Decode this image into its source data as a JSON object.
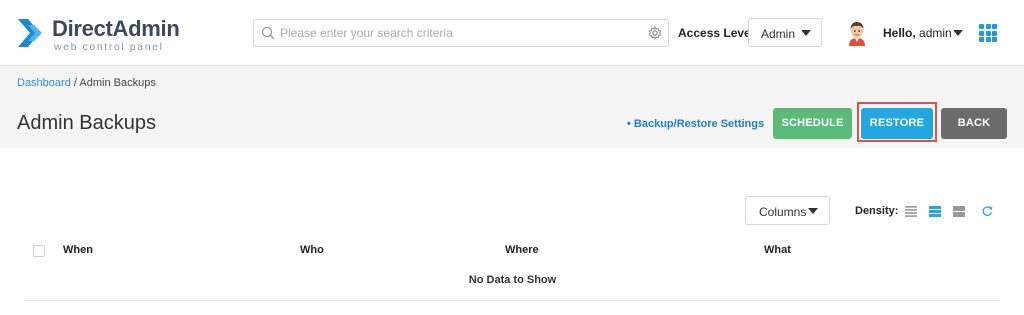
{
  "header": {
    "logo": {
      "title": "DirectAdmin",
      "subtitle": "web control panel"
    },
    "search": {
      "placeholder": "Please enter your search criteria",
      "value": ""
    },
    "access_level": {
      "label": "Access Level",
      "selected": "Admin"
    },
    "user": {
      "greeting": "Hello,",
      "name": "admin"
    }
  },
  "breadcrumb": {
    "link": "Dashboard",
    "separator": " / ",
    "current": "Admin Backups"
  },
  "page": {
    "title": "Admin Backups",
    "settings_link": "• Backup/Restore Settings",
    "buttons": {
      "schedule": "SCHEDULE",
      "restore": "RESTORE",
      "back": "BACK"
    }
  },
  "toolbar": {
    "columns_label": "Columns",
    "density_label": "Density:",
    "density_selected": "medium"
  },
  "table": {
    "columns": [
      "When",
      "Who",
      "Where",
      "What"
    ],
    "rows": [],
    "empty_text": "No Data to Show"
  },
  "colors": {
    "accent": "#23a7e0",
    "schedule": "#5dbb79",
    "back": "#6b6b6b",
    "link": "#1b7fc4",
    "highlight": "#d9534f"
  }
}
